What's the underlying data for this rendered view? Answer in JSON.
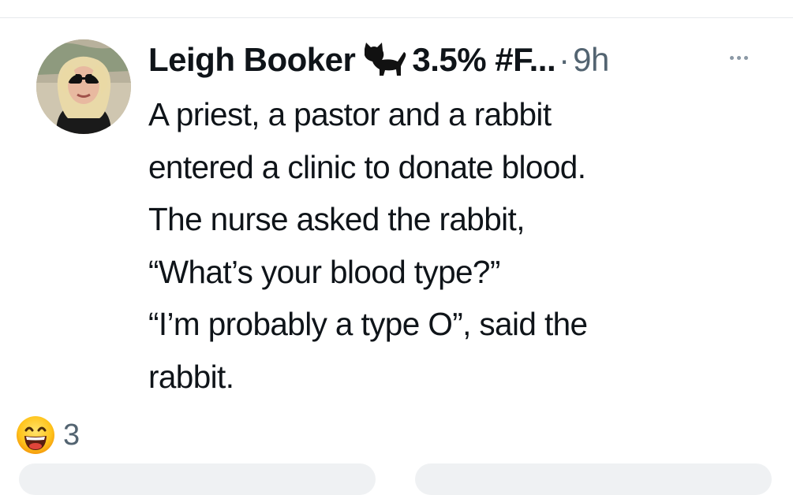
{
  "post": {
    "display_name": "Leigh Booker",
    "name_icon": "black-cat-icon",
    "handle": "3.5% #F...",
    "separator": "·",
    "time": "9h",
    "body_lines": [
      "A priest, a pastor and a rabbit",
      "entered a clinic to donate blood.",
      "The nurse asked the rabbit,",
      "“What’s your blood type?”",
      "“I’m probably a type O”, said the",
      "rabbit."
    ]
  },
  "reaction": {
    "icon": "grinning-face-emoji-icon",
    "count": "3"
  },
  "colors": {
    "text": "#0f1419",
    "secondary": "#536471",
    "divider": "#e6e9ec"
  }
}
